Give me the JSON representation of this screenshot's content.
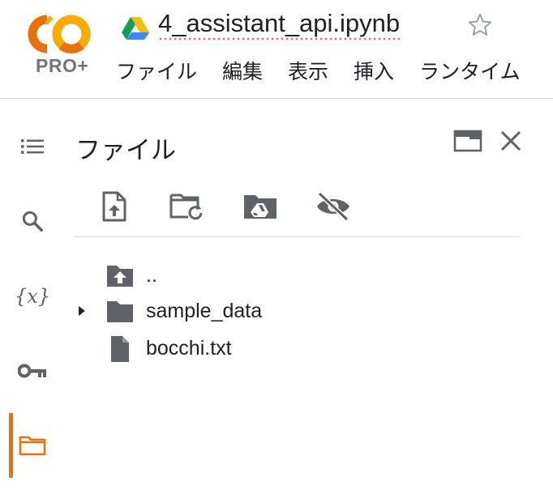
{
  "app": {
    "logo_text": "CO",
    "plan_badge": "PRO+",
    "notebook_title": "4_assistant_api.ipynb",
    "brand_colors": {
      "logo_orange": "#f9ab00",
      "logo_dark_orange": "#e8710a",
      "active_accent": "#e8710a"
    }
  },
  "menu": {
    "items": [
      "ファイル",
      "編集",
      "表示",
      "挿入",
      "ランタイム"
    ]
  },
  "rail": {
    "items": [
      {
        "name": "toc",
        "icon": "list-icon"
      },
      {
        "name": "search",
        "icon": "search-icon"
      },
      {
        "name": "variables",
        "icon": "variables-icon",
        "glyph": "{x}"
      },
      {
        "name": "secrets",
        "icon": "key-icon"
      },
      {
        "name": "files",
        "icon": "folder-icon",
        "active": true
      }
    ]
  },
  "files_panel": {
    "title": "ファイル",
    "toolbar": [
      {
        "name": "upload",
        "icon": "upload-file-icon"
      },
      {
        "name": "refresh",
        "icon": "folder-refresh-icon"
      },
      {
        "name": "mount-drive",
        "icon": "drive-folder-icon"
      },
      {
        "name": "toggle-hidden",
        "icon": "eye-off-icon"
      }
    ],
    "tree": [
      {
        "label": "..",
        "icon": "folder-up-icon",
        "expandable": false
      },
      {
        "label": "sample_data",
        "icon": "folder-icon",
        "expandable": true
      },
      {
        "label": "bocchi.txt",
        "icon": "file-icon",
        "expandable": false
      }
    ]
  }
}
